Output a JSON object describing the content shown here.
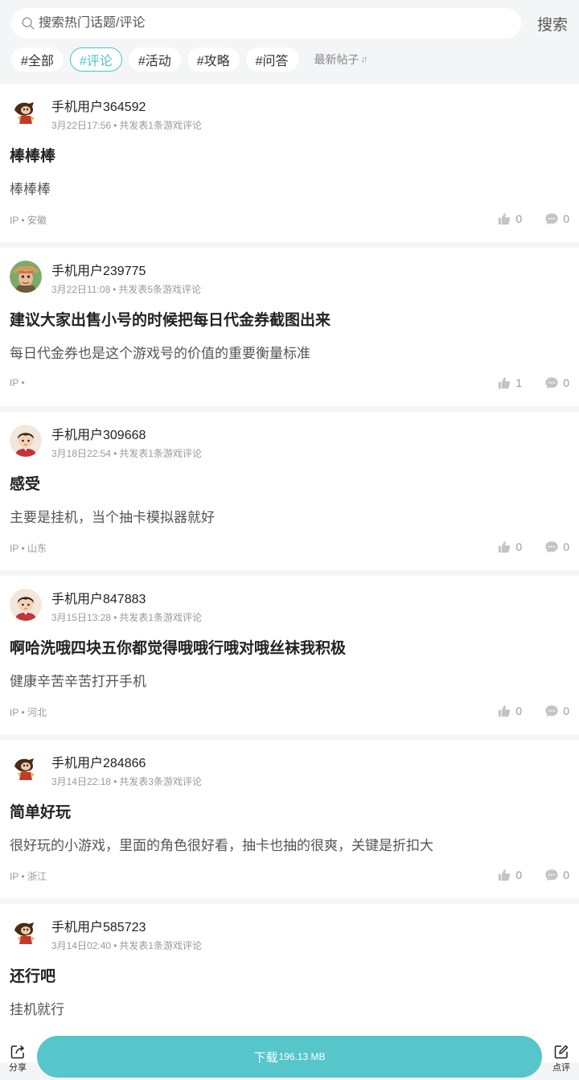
{
  "search": {
    "placeholder": "搜索热门话题/评论",
    "button": "搜索"
  },
  "tabs": [
    {
      "label": "#全部",
      "active": false
    },
    {
      "label": "#评论",
      "active": true
    },
    {
      "label": "#活动",
      "active": false
    },
    {
      "label": "#攻略",
      "active": false
    },
    {
      "label": "#问答",
      "active": false
    }
  ],
  "sort": {
    "label": "最新帖子",
    "icon": "sort-arrows-icon"
  },
  "colors": {
    "accent": "#4ec3c8",
    "download": "#56c6cb",
    "background": "#f4f5f7"
  },
  "posts": [
    {
      "user": "手机用户364592",
      "date": "3月22日17:56",
      "stats": "共发表1条游戏评论",
      "title": "棒棒棒",
      "body": "棒棒棒",
      "ip_label": "IP",
      "ip_region": "安徽",
      "likes": "0",
      "comments": "0",
      "avatar": "monkey-avatar"
    },
    {
      "user": "手机用户239775",
      "date": "3月22日11:08",
      "stats": "共发表5条游戏评论",
      "title": "建议大家出售小号的时候把每日代金券截图出来",
      "body": "每日代金券也是这个游戏号的价值的重要衡量标准",
      "ip_label": "IP",
      "ip_region": "",
      "likes": "1",
      "comments": "0",
      "avatar": "warrior-avatar"
    },
    {
      "user": "手机用户309668",
      "date": "3月18日22:54",
      "stats": "共发表1条游戏评论",
      "title": "感受",
      "body": "主要是挂机，当个抽卡模拟器就好",
      "ip_label": "IP",
      "ip_region": "山东",
      "likes": "0",
      "comments": "0",
      "avatar": "boy-avatar"
    },
    {
      "user": "手机用户847883",
      "date": "3月15日13:28",
      "stats": "共发表1条游戏评论",
      "title": "啊哈洗哦四块五你都觉得哦哦行哦对哦丝袜我积极",
      "body": "健康辛苦辛苦打开手机",
      "ip_label": "IP",
      "ip_region": "河北",
      "likes": "0",
      "comments": "0",
      "avatar": "boy-avatar"
    },
    {
      "user": "手机用户284866",
      "date": "3月14日22:18",
      "stats": "共发表3条游戏评论",
      "title": "简单好玩",
      "body": "很好玩的小游戏，里面的角色很好看，抽卡也抽的很爽，关键是折扣大",
      "ip_label": "IP",
      "ip_region": "浙江",
      "likes": "0",
      "comments": "0",
      "avatar": "monkey-avatar"
    },
    {
      "user": "手机用户585723",
      "date": "3月14日02:40",
      "stats": "共发表1条游戏评论",
      "title": "还行吧",
      "body": "挂机就行",
      "ip_label": "IP",
      "ip_region": "",
      "likes": "",
      "comments": "",
      "avatar": "monkey-avatar"
    }
  ],
  "bottom": {
    "share": "分享",
    "download_label": "下载",
    "download_size": "196.13 MB",
    "review": "点评"
  }
}
